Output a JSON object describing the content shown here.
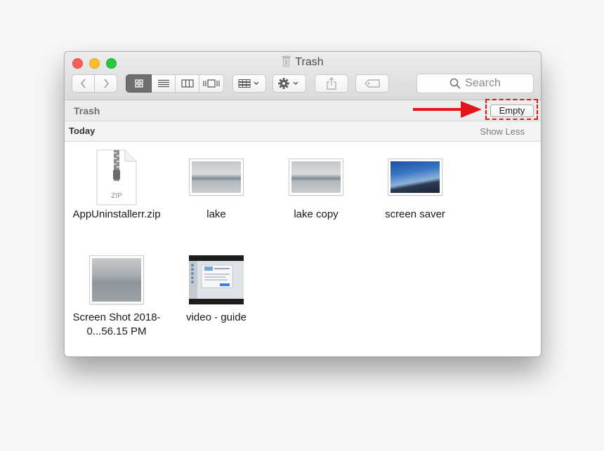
{
  "window": {
    "title": "Trash",
    "title_icon": "trash-icon"
  },
  "toolbar": {
    "back_icon": "chevron-left-icon",
    "forward_icon": "chevron-right-icon",
    "view_modes": [
      "icon-view",
      "list-view",
      "column-view",
      "cover-flow-view"
    ],
    "active_view": "icon-view",
    "arrange_icon": "arrange-icon",
    "action_icon": "gear-icon",
    "share_icon": "share-icon",
    "tag_icon": "tag-icon",
    "search_label": "Search"
  },
  "pathbar": {
    "location": "Trash",
    "empty_label": "Empty"
  },
  "section": {
    "title": "Today",
    "toggle_label": "Show Less"
  },
  "files": [
    {
      "name": "AppUninstallerr.zip",
      "kind": "zip",
      "badge": "ZIP"
    },
    {
      "name": "lake",
      "kind": "photo-fog"
    },
    {
      "name": "lake copy",
      "kind": "photo-fog"
    },
    {
      "name": "screen saver",
      "kind": "photo-sky"
    },
    {
      "name": "Screen Shot 2018-0...56.15 PM",
      "kind": "photo-grey"
    },
    {
      "name": "video - guide",
      "kind": "video"
    }
  ],
  "annotation": {
    "color": "#e6141c",
    "arrow_icon": "red-arrow-icon"
  }
}
